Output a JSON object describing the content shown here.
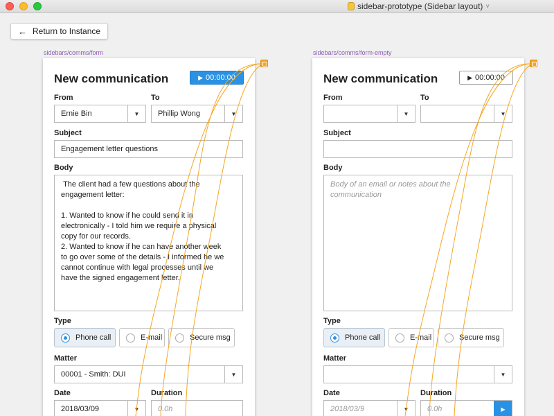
{
  "window": {
    "title": "sidebar-prototype (Sidebar layout)",
    "doc_icon": "document-icon",
    "menu_chevron": "˅"
  },
  "return_button": {
    "label": "Return to Instance",
    "icon": "←"
  },
  "frames": [
    {
      "path_label": "sidebars/comms/form",
      "heading": "New communication",
      "timer": {
        "value": "00:00:00",
        "state": "active",
        "icon": "▶"
      },
      "labels": {
        "from": "From",
        "to": "To",
        "subject": "Subject",
        "body": "Body",
        "type": "Type",
        "matter": "Matter",
        "date": "Date",
        "duration": "Duration"
      },
      "from_value": "Ernie Bin",
      "to_value": "Phillip Wong",
      "subject_value": "Engagement letter questions",
      "body_value": " The client had a few questions about the\nengagement letter:\n\n1. Wanted to know if he could send it in\nelectronically - I told him we require a physical\ncopy for our records.\n2. Wanted to know if he can have another week\nto go over some of the details - I informed he we\ncannot continue with legal processes until we\nhave the signed engagement letter.",
      "type_options": [
        "Phone call",
        "E-mail",
        "Secure msg"
      ],
      "type_selected": "Phone call",
      "matter_value": "00001 - Smith: DUI",
      "date_value": "2018/03/09",
      "duration_placeholder": "0.0h"
    },
    {
      "path_label": "sidebars/comms/form-empty",
      "heading": "New communication",
      "timer": {
        "value": "00:00:00",
        "state": "idle",
        "icon": "▶"
      },
      "labels": {
        "from": "From",
        "to": "To",
        "subject": "Subject",
        "body": "Body",
        "type": "Type",
        "matter": "Matter",
        "date": "Date",
        "duration": "Duration"
      },
      "from_value": "",
      "to_value": "",
      "subject_value": "",
      "body_placeholder": "Body of an email or notes about the\ncommunication",
      "type_options": [
        "Phone call",
        "E-mail",
        "Secure msg"
      ],
      "type_selected": "Phone call",
      "matter_value": "",
      "date_placeholder": "2018/03/9",
      "duration_placeholder": "0.0h"
    }
  ],
  "colors": {
    "accent": "#2a92e4",
    "link_line": "#f5a623",
    "frame_label": "#8c5bb5"
  },
  "dropdown_icon": "▼"
}
